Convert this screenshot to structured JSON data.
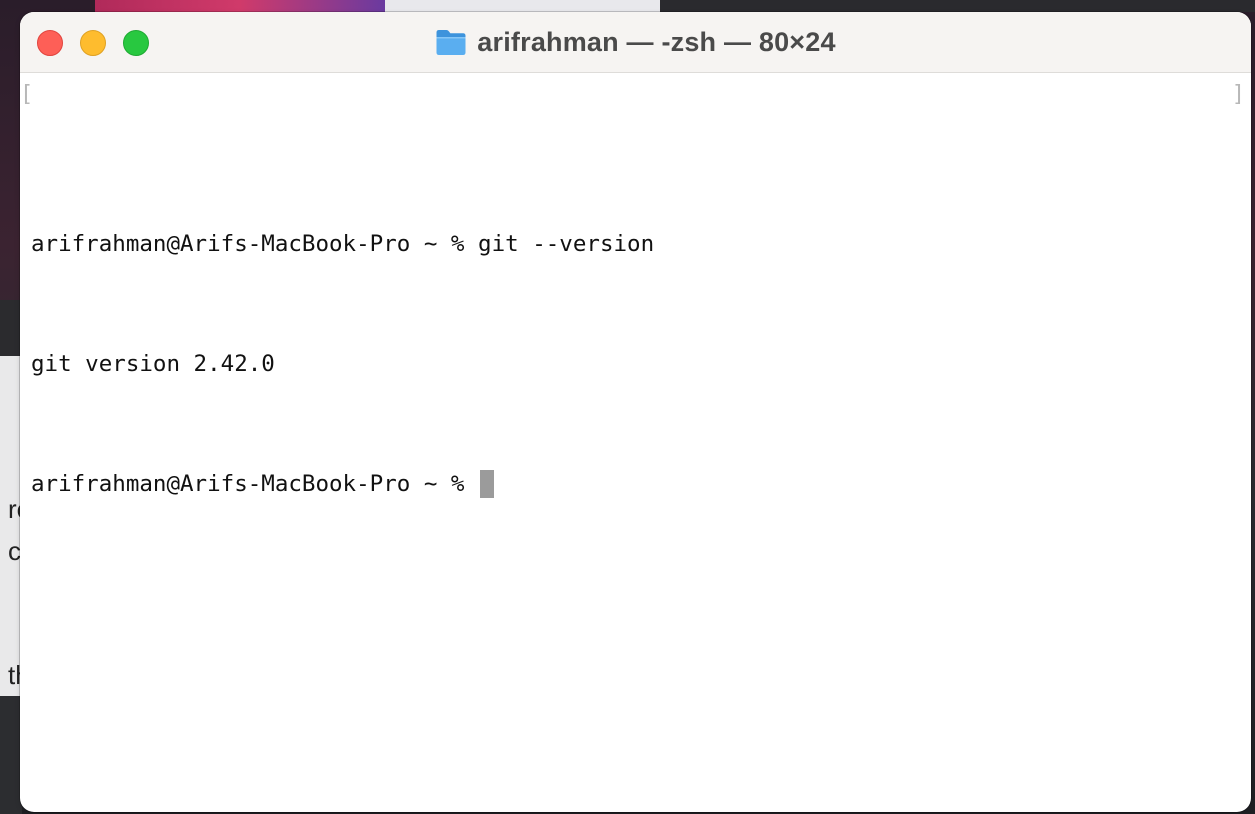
{
  "window": {
    "title": "arifrahman — -zsh — 80×24"
  },
  "terminal": {
    "lines": [
      {
        "prompt": "arifrahman@Arifs-MacBook-Pro ~ % ",
        "command": "git --version"
      },
      {
        "output": "git version 2.42.0"
      },
      {
        "prompt": "arifrahman@Arifs-MacBook-Pro ~ % ",
        "command": ""
      }
    ]
  },
  "backdrop": {
    "fragments": [
      "re",
      "c",
      "th"
    ]
  },
  "colors": {
    "close": "#fe5f57",
    "minimize": "#febc2e",
    "maximize": "#28c840",
    "folder": "#5aaef0"
  }
}
